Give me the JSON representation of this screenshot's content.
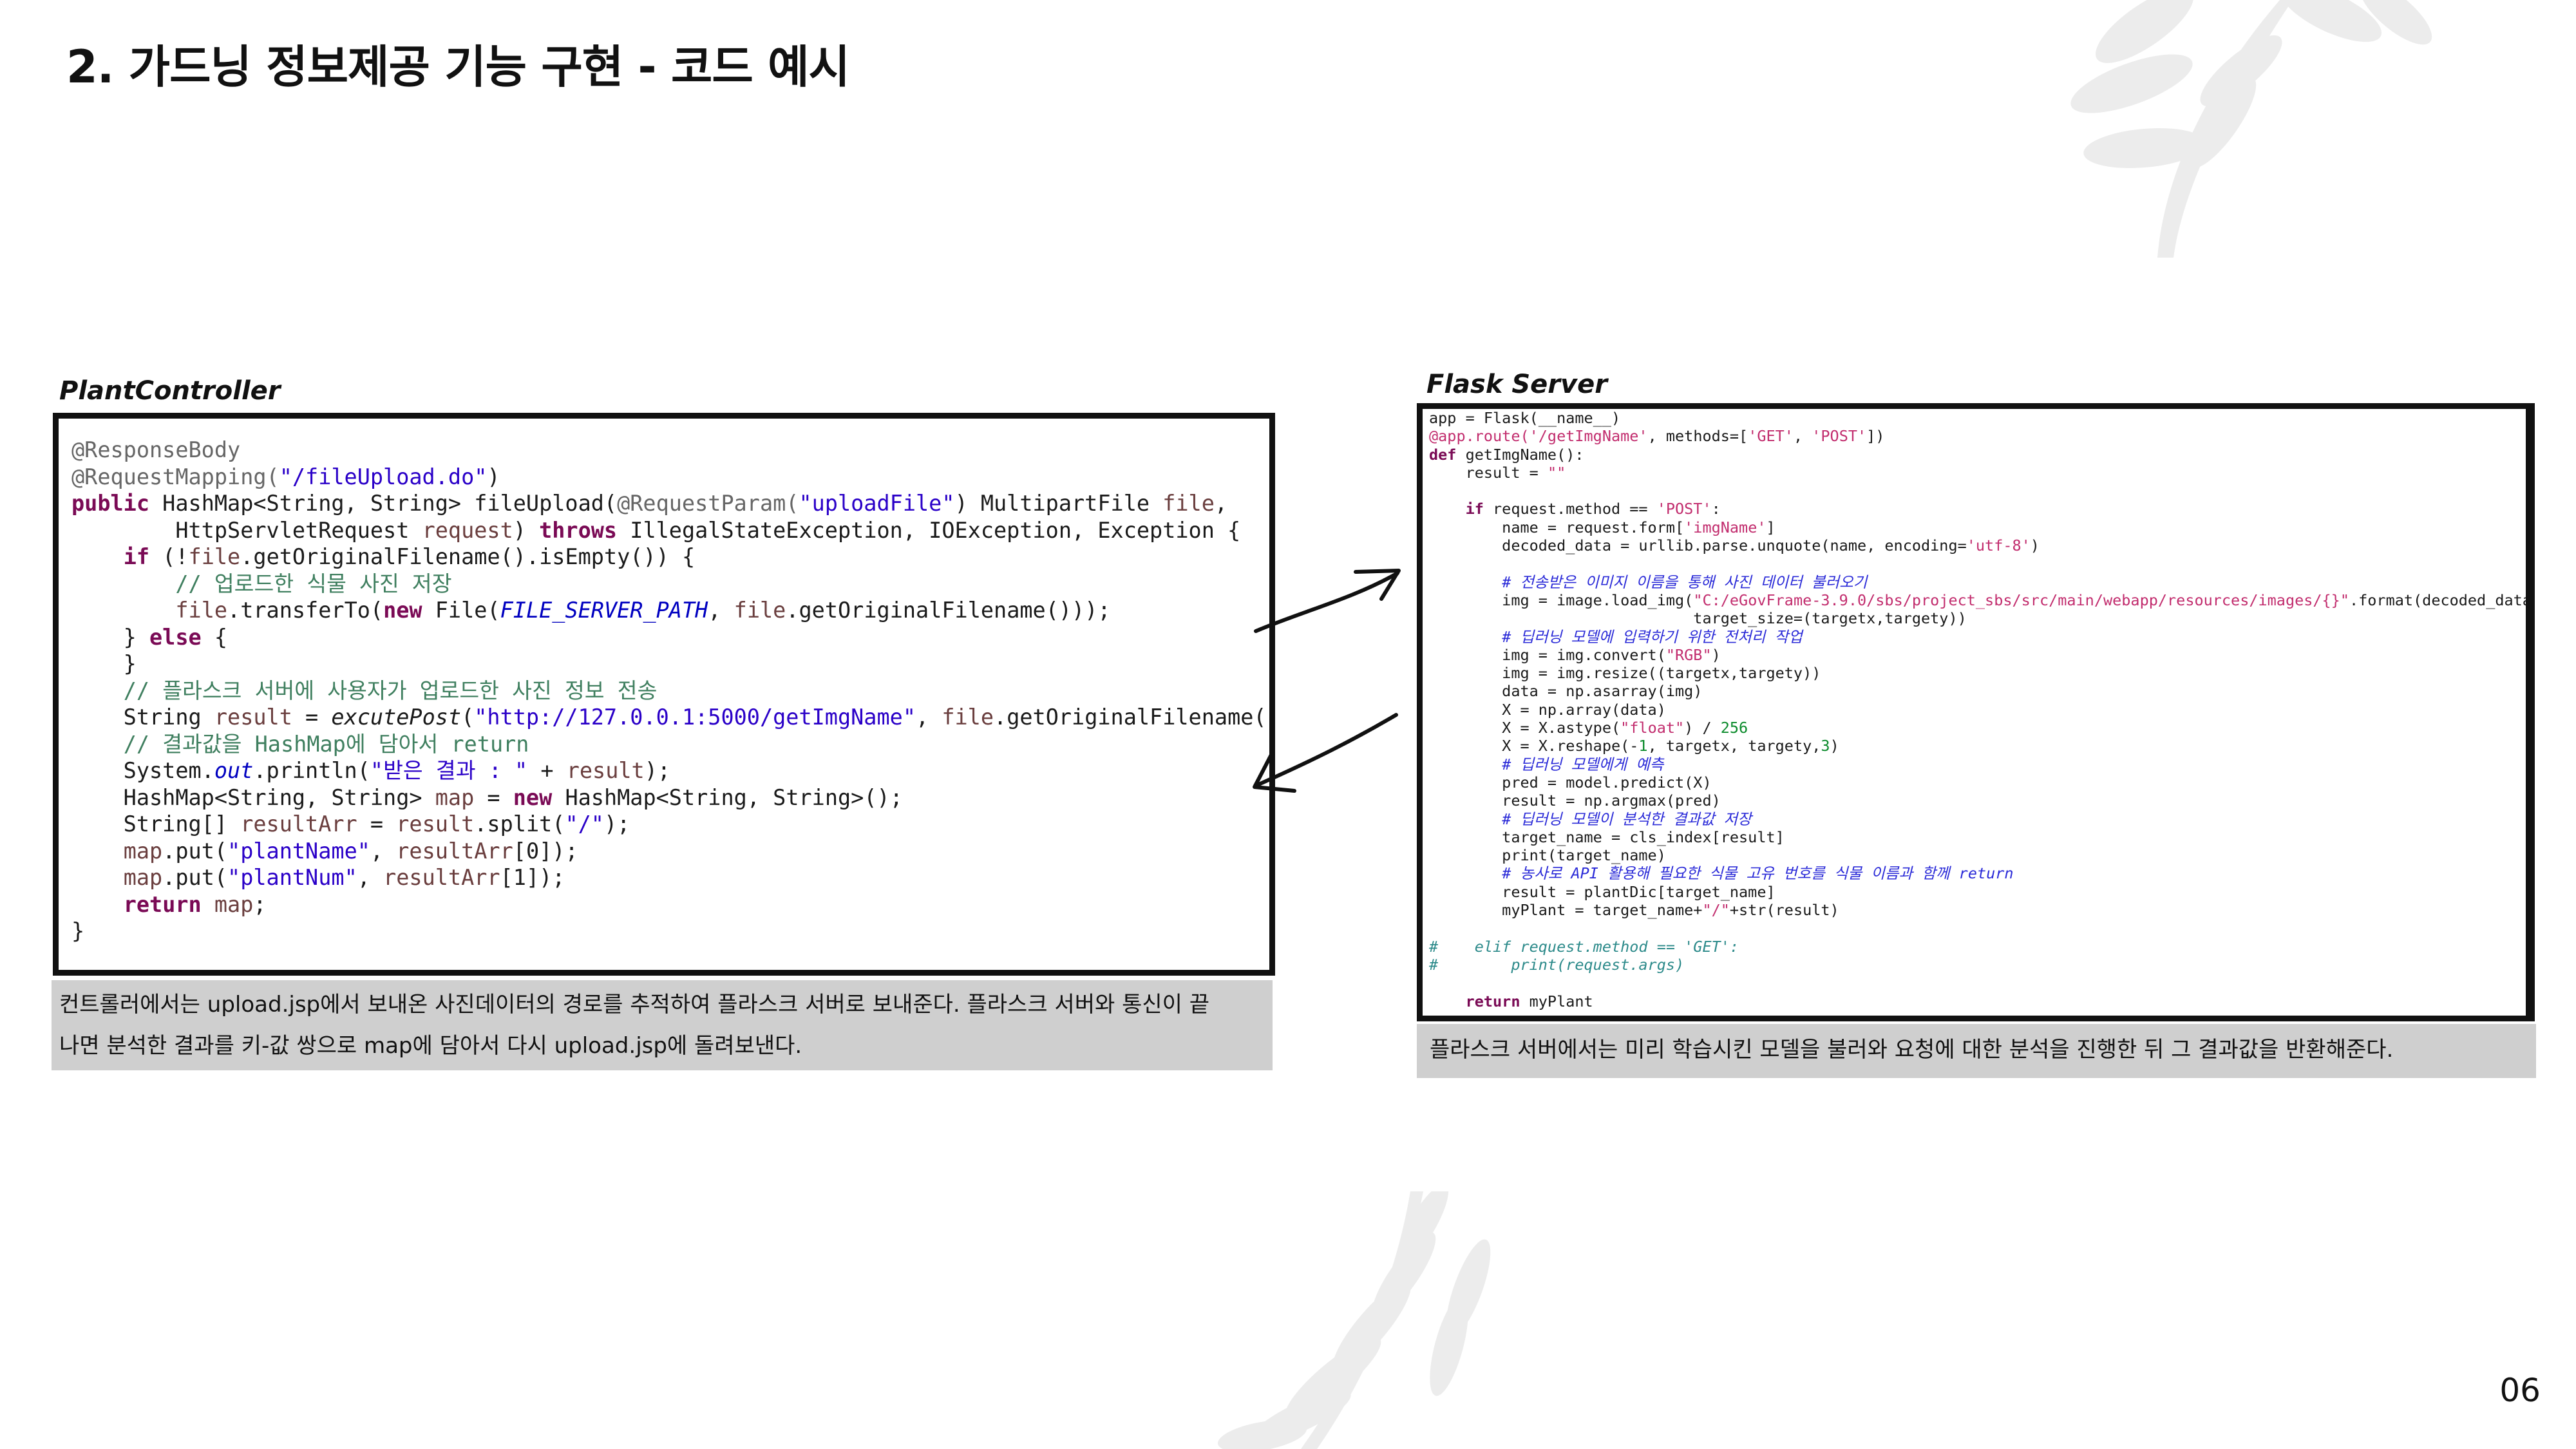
{
  "title": "2. 가드닝 정보제공 기능 구현 - 코드 예시",
  "page_number": "06",
  "left_panel": {
    "label": "PlantController",
    "description_lines": [
      "컨트롤러에서는 upload.jsp에서 보내온 사진데이터의 경로를 추적하여 플라스크 서버로 보내준다. 플라스크 서버와 통신이 끝",
      "나면 분석한 결과를 키-값 쌍으로 map에 담아서 다시 upload.jsp에 돌려보낸다."
    ]
  },
  "right_panel": {
    "label": "Flask Server",
    "description": "플라스크 서버에서는 미리 학습시킨 모델을 불러와 요청에 대한 분석을 진행한 뒤 그 결과값을 반환해준다."
  },
  "colors": {
    "caption_bg": "#cfcfcf",
    "leaf": "#ececec",
    "border": "#111111"
  }
}
